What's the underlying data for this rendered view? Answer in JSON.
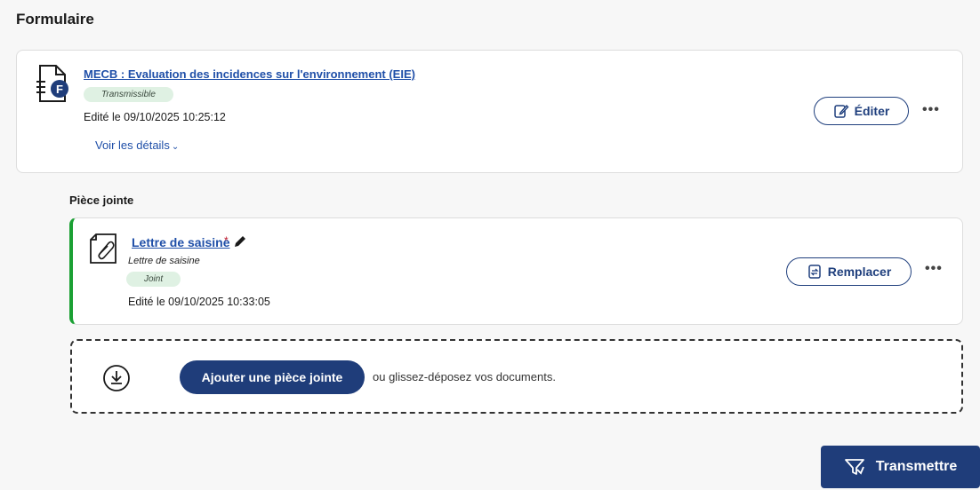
{
  "page": {
    "section_title": "Formulaire"
  },
  "form_card": {
    "title": "MECB : Evaluation des incidences sur l'environnement (EIE)",
    "badge": "Transmissible",
    "edited": "Edité le 09/10/2025 10:25:12",
    "details_link": "Voir les détails",
    "edit_button": "Éditer",
    "more": "•••",
    "icon_letter": "F"
  },
  "attachments": {
    "heading": "Pièce jointe",
    "item": {
      "title": "Lettre de saisine",
      "required_mark": "*",
      "subtitle": "Lettre de saisine",
      "badge": "Joint",
      "edited": "Edité le 09/10/2025 10:33:05",
      "replace_button": "Remplacer",
      "more": "•••"
    },
    "dropzone": {
      "add_button": "Ajouter une pièce jointe",
      "hint": "ou glissez-déposez vos documents."
    }
  },
  "footer": {
    "transmit_button": "Transmettre"
  },
  "colors": {
    "primary": "#1f3d7a",
    "link": "#1f4fa8",
    "success_border": "#1aa033",
    "badge_bg": "#dff1e3"
  },
  "icons": [
    "form-document-icon",
    "pencil-icon",
    "edit-icon",
    "more-icon",
    "attachment-document-icon",
    "replace-icon",
    "download-icon",
    "send-icon"
  ]
}
